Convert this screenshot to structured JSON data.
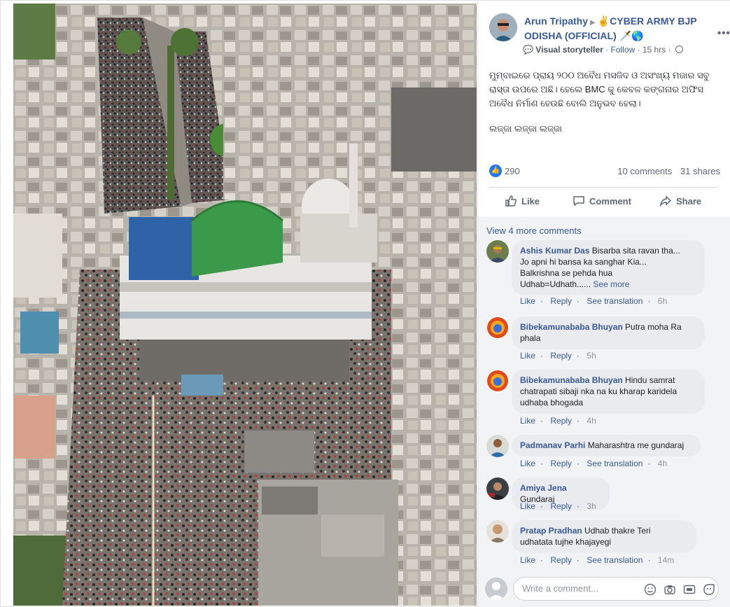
{
  "post": {
    "author": "Arun Tripathy",
    "group": "✌️CYBER ARMY BJP ODISHA (OFFICIAL) 🗡️🌎",
    "badge": "Visual storyteller",
    "follow": "Follow",
    "time": "15 hrs",
    "text_lines": [
      "ମୁମ୍ବାଇରେ ପ୍ରାୟ ୨୦୦ ଅବୈଧ ମସଜିଦ ଓ ଅସଂଖ୍ୟ ମଜାର ସବୁ ରାସ୍ତା ଉପରେ ଅଛି। ହେଲେ BMC କୁ କେବଳ କଙ୍ଗନାର ଅଫିସ ଅବୈଧ ନିର୍ମାଣ ହେଉଛି ବୋଲି ଅନୁଭବ ହେଲା।",
      "ଲଜ୍ଜା ଲଜ୍ଜା ଲଜ୍ଜା"
    ],
    "reaction_count": "290",
    "comments_count": "10 comments",
    "shares_count": "31 shares"
  },
  "actions": {
    "like": "Like",
    "comment": "Comment",
    "share": "Share"
  },
  "comments": {
    "view_more": "View 4 more comments",
    "items": [
      {
        "name": "Ashis Kumar Das",
        "text": "Bisarba sita ravan tha...\nJo apni hi bansa ka sanghar Kia...\nBalkrishna se pehda hua\nUdhab=Udhath......",
        "see_more": "See more",
        "like": "Like",
        "reply": "Reply",
        "translate": "See translation",
        "time": "6h"
      },
      {
        "name": "Bibekamunababa Bhuyan",
        "text": "Putra moha Ra\nphala",
        "like": "Like",
        "reply": "Reply",
        "time": "5h"
      },
      {
        "name": "Bibekamunababa Bhuyan",
        "text": "Hindu samrat\nchatrapati sibaji nka na ku kharap karidela\nudhaba bhogada",
        "like": "Like",
        "reply": "Reply",
        "time": "4h"
      },
      {
        "name": "Padmanav Parhi",
        "text": "Maharashtra me gundaraj",
        "like": "Like",
        "reply": "Reply",
        "translate": "See translation",
        "time": "4h"
      },
      {
        "name": "Amiya Jena",
        "text": "Gundaraj",
        "like": "Like",
        "reply": "Reply",
        "time": "3h"
      },
      {
        "name": "Pratap Pradhan",
        "text": "Udhab thakre Teri\nudhatata tujhe khajayegi",
        "like": "Like",
        "reply": "Reply",
        "translate": "See translation",
        "time": "14m"
      }
    ]
  },
  "composer": {
    "placeholder": "Write a comment..."
  },
  "colors": {
    "link": "#385898",
    "meta": "#606770",
    "bubble": "#e9ebee",
    "panel_bg": "#f2f3f5",
    "like_blue": "#2078f4",
    "dome_green": "#3a9a4a"
  },
  "icons": [
    "more-icon",
    "play-arrow-icon",
    "storyteller-icon",
    "globe-icon",
    "like-reaction-icon",
    "like-icon",
    "comment-icon",
    "share-icon",
    "emoji-icon",
    "camera-icon",
    "gif-icon",
    "sticker-icon"
  ]
}
